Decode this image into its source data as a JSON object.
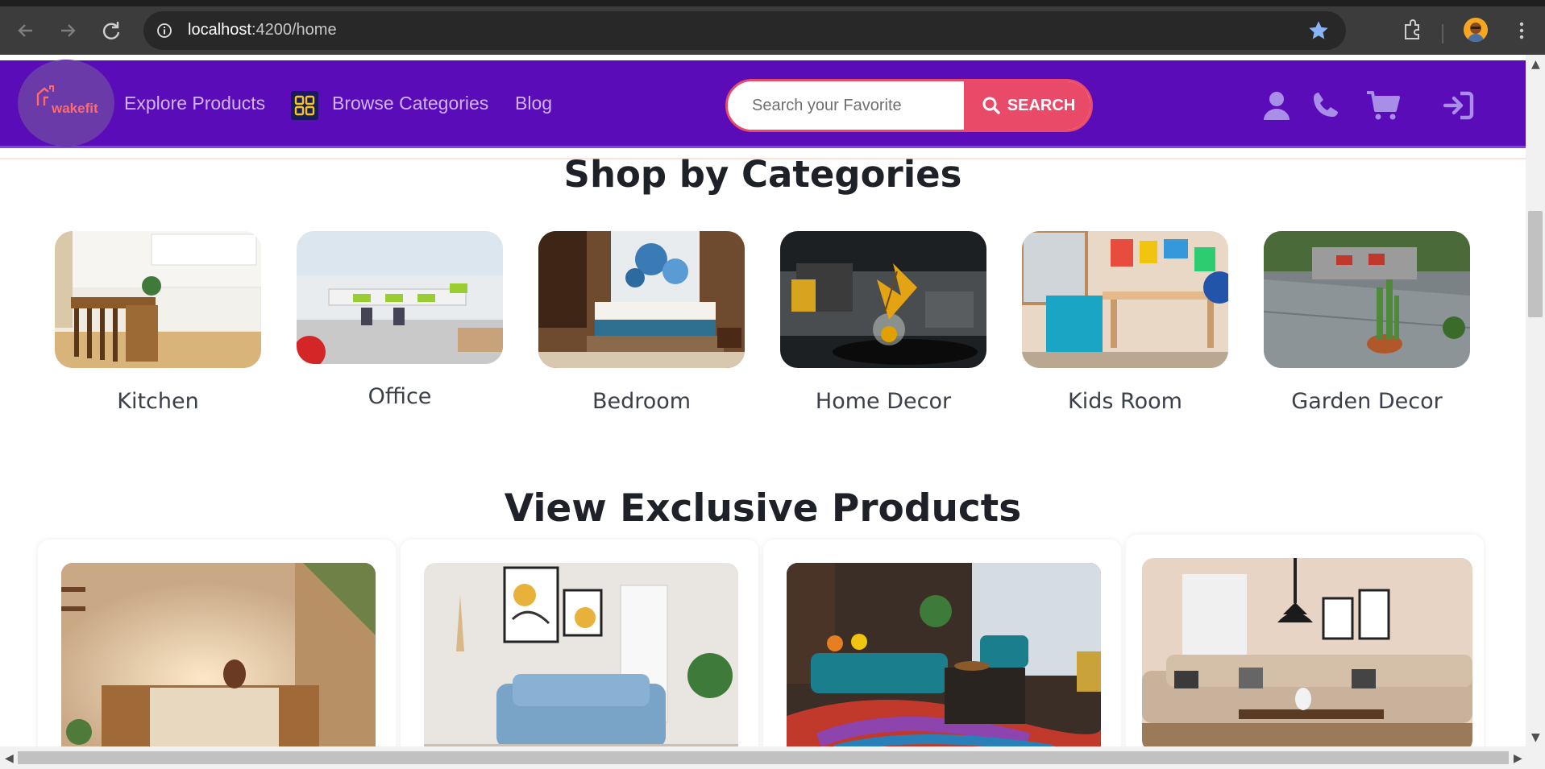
{
  "browser": {
    "url_host": "localhost",
    "url_path": ":4200/home",
    "icons": [
      "back-arrow-icon",
      "forward-arrow-icon",
      "reload-icon",
      "info-icon",
      "star-icon",
      "extensions-icon",
      "menu-dots-icon"
    ]
  },
  "header": {
    "logo_text": "wakefit",
    "nav": {
      "explore": "Explore Products",
      "browse": "Browse Categories",
      "blog": "Blog"
    },
    "search": {
      "placeholder": "Search your Favorite",
      "button_label": "SEARCH"
    },
    "icons": [
      "user-icon",
      "phone-icon",
      "cart-icon",
      "sign-in-icon"
    ],
    "colors": {
      "bg": "#5a0cb8",
      "accent": "#e84a68",
      "link": "#d1b4ff"
    }
  },
  "categories": {
    "title": "Shop by Categories",
    "items": [
      {
        "label": "Kitchen"
      },
      {
        "label": "Office"
      },
      {
        "label": "Bedroom"
      },
      {
        "label": "Home Decor"
      },
      {
        "label": "Kids Room"
      },
      {
        "label": "Garden Decor"
      }
    ]
  },
  "products": {
    "title": "View Exclusive Products"
  }
}
